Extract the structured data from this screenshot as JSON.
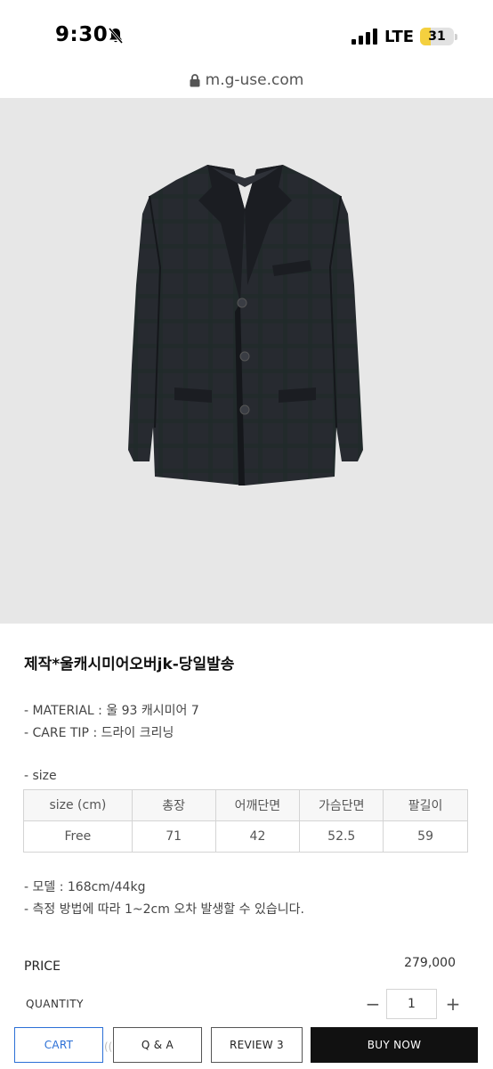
{
  "status_bar": {
    "time": "9:30",
    "network": "LTE",
    "battery": "31",
    "battery_level": 0.31,
    "icons": [
      "bell-off-icon",
      "signal-icon",
      "battery-icon"
    ]
  },
  "url_bar": {
    "url": "m.g-use.com",
    "icon": "lock-icon"
  },
  "product": {
    "image_icon": "jacket-image",
    "title": "제작*울캐시미어오버jk-당일발송",
    "material": "- MATERIAL : 울 93 캐시미어 7",
    "care_tip": "- CARE TIP : 드라이 크리닝",
    "size_label": "- size",
    "size_table": {
      "headers": [
        "size (cm)",
        "총장",
        "어깨단면",
        "가슴단면",
        "팔길이"
      ],
      "rows": [
        [
          "Free",
          "71",
          "42",
          "52.5",
          "59"
        ]
      ]
    },
    "model": "- 모델 : 168cm/44kg",
    "measure_note": "- 측정 방법에 따라 1~2cm 오차 발생할 수 있습니다."
  },
  "purchase": {
    "price_label": "PRICE",
    "price_value": "279,000",
    "quantity_label": "QUANTITY",
    "quantity_value": "1",
    "minus": "−",
    "plus": "+"
  },
  "bottom_bar": {
    "cart": "CART",
    "qna": "Q & A",
    "review": "REVIEW 3",
    "buy_now": "BUY NOW",
    "ghost": "(("
  },
  "colors": {
    "accent": "#2b6fd6",
    "buy_bg": "#111111",
    "image_bg": "#e7e7e7"
  }
}
